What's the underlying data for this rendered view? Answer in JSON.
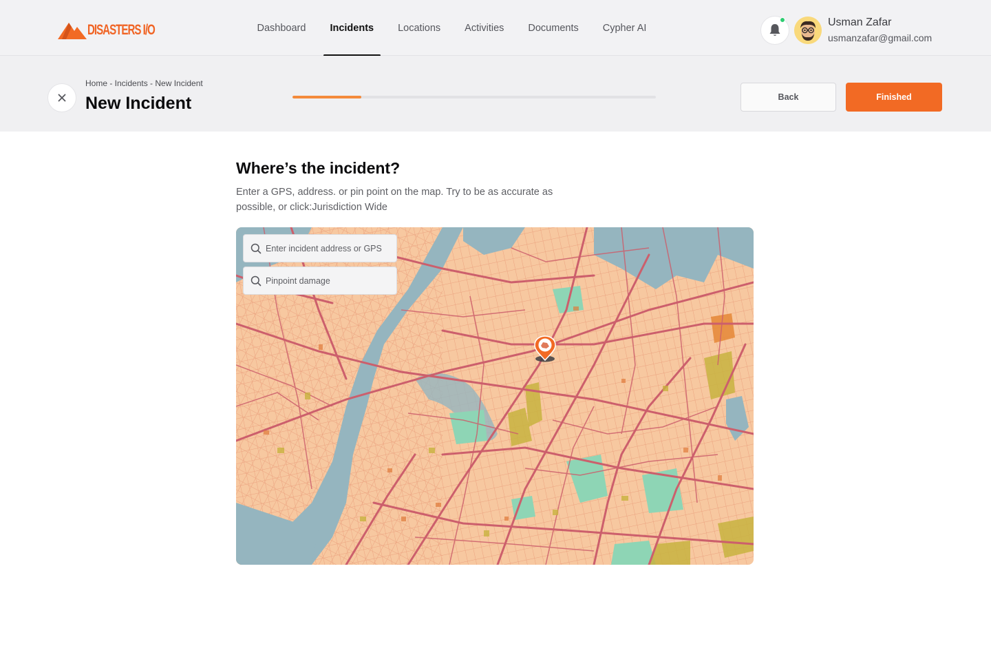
{
  "brand": {
    "name": "DISASTERS I/O",
    "accent": "#f26a24"
  },
  "nav": {
    "items": [
      {
        "label": "Dashboard",
        "active": false
      },
      {
        "label": "Incidents",
        "active": true
      },
      {
        "label": "Locations",
        "active": false
      },
      {
        "label": "Activities",
        "active": false
      },
      {
        "label": "Documents",
        "active": false
      },
      {
        "label": "Cypher AI",
        "active": false
      }
    ]
  },
  "user": {
    "name": "Usman Zafar",
    "email": "usmanzafar@gmail.com",
    "notification_status_color": "#2ecc71"
  },
  "header": {
    "breadcrumb": "Home - Incidents - New Incident",
    "title": "New Incident",
    "progress_percent": 19,
    "back_label": "Back",
    "finished_label": "Finished"
  },
  "step": {
    "title": "Where’s the incident?",
    "description": "Enter a GPS, address. or pin point on the map. Try to be as accurate as possible, or click:Jurisdiction Wide"
  },
  "map": {
    "address_placeholder": "Enter incident address or GPS",
    "pinpoint_placeholder": "Pinpoint damage",
    "icons": [
      "search-icon",
      "map-pin-icon"
    ],
    "colors": {
      "water": "#95b5bf",
      "land": "#f7c8a0",
      "roads": "#cc5f6c",
      "parks": "#8ed5b5"
    }
  }
}
